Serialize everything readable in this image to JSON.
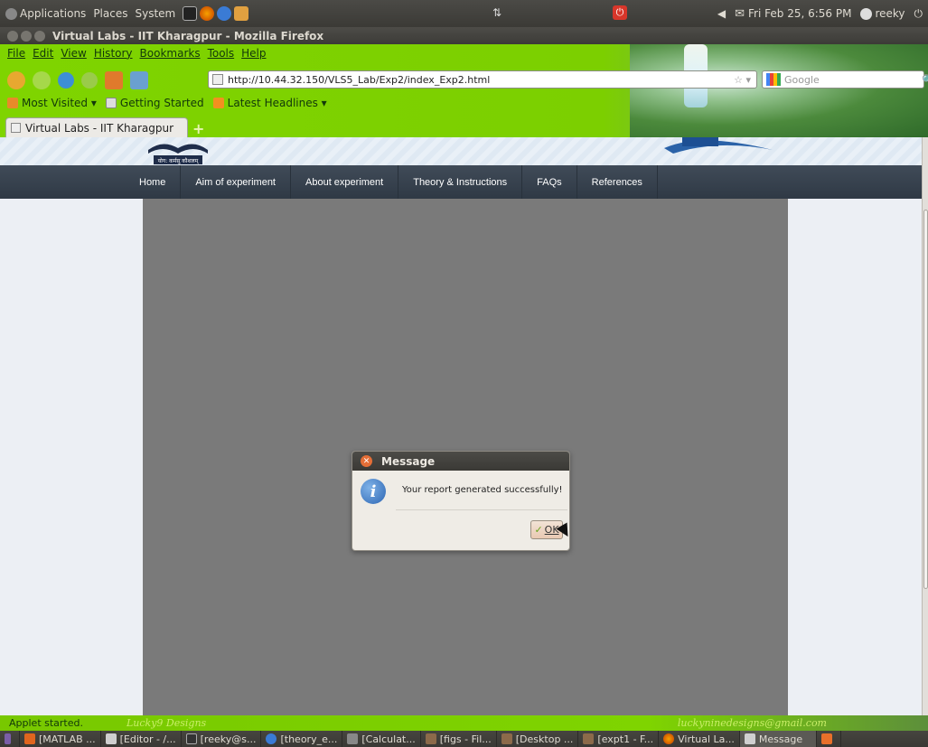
{
  "top_panel": {
    "menus": [
      "Applications",
      "Places",
      "System"
    ],
    "clock": "Fri Feb 25,  6:56 PM",
    "user": "reeky"
  },
  "window": {
    "title": "Virtual Labs - IIT Kharagpur - Mozilla Firefox"
  },
  "menubar": [
    "File",
    "Edit",
    "View",
    "History",
    "Bookmarks",
    "Tools",
    "Help"
  ],
  "navbar": {
    "url": "http://10.44.32.150/VLS5_Lab/Exp2/index_Exp2.html",
    "search_placeholder": "Google"
  },
  "bookmarks": [
    {
      "label": "Most Visited",
      "icon": "star-folder-icon"
    },
    {
      "label": "Getting Started",
      "icon": "page-icon"
    },
    {
      "label": "Latest Headlines",
      "icon": "rss-icon"
    }
  ],
  "tab": {
    "label": "Virtual Labs - IIT Kharagpur"
  },
  "site": {
    "nav": [
      "Home",
      "Aim of experiment",
      "About experiment",
      "Theory & Instructions",
      "FAQs",
      "References"
    ],
    "logo_caption": "योग: कर्मसु कौशलम्"
  },
  "dialog": {
    "title": "Message",
    "message": "Your report generated successfully!",
    "ok_label": "OK"
  },
  "statusbar": {
    "status": "Applet started.",
    "brand": "Lucky9 Designs",
    "email": "luckyninedesigns@gmail.com"
  },
  "taskbar": [
    {
      "label": "[MATLAB ..."
    },
    {
      "label": "[Editor - /..."
    },
    {
      "label": "[reeky@s..."
    },
    {
      "label": "[theory_e..."
    },
    {
      "label": "[Calculat..."
    },
    {
      "label": "[figs - Fil..."
    },
    {
      "label": "[Desktop ..."
    },
    {
      "label": "[expt1 - F..."
    },
    {
      "label": "Virtual La..."
    },
    {
      "label": "Message"
    }
  ],
  "colors": {
    "firefox_persona_green": "#7fd400",
    "site_nav_bg": "#3a4451",
    "content_gray": "#7a7a7a",
    "ok_button": "#ebcdb8"
  }
}
